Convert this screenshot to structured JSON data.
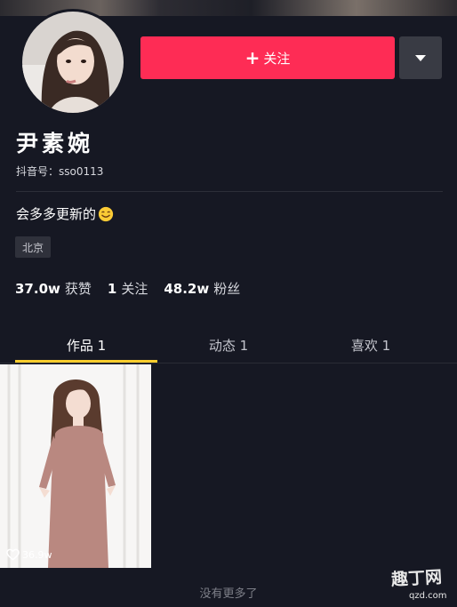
{
  "profile": {
    "nickname": "尹素婉",
    "douyin_id": "抖音号：sso0113",
    "bio": "会多多更新的",
    "bio_icon": "smile-emoji-icon",
    "location": "北京"
  },
  "actions": {
    "follow_label": "关注",
    "follow_icon": "+",
    "more_icon": "dropdown-triangle-icon"
  },
  "stats": [
    {
      "value": "37.0w",
      "label": "获赞"
    },
    {
      "value": "1",
      "label": "关注"
    },
    {
      "value": "48.2w",
      "label": "粉丝"
    }
  ],
  "tabs": [
    {
      "label": "作品 1",
      "active": true
    },
    {
      "label": "动态 1",
      "active": false
    },
    {
      "label": "喜欢 1",
      "active": false
    }
  ],
  "videos": [
    {
      "likes": "36.9w",
      "icon": "heart-icon"
    }
  ],
  "footer": {
    "no_more": "没有更多了"
  },
  "watermark": {
    "main": "趣丁网",
    "sub": "qzd.com"
  },
  "colors": {
    "background": "#161823",
    "follow_button": "#fe2c55",
    "tab_indicator": "#facd2d"
  }
}
